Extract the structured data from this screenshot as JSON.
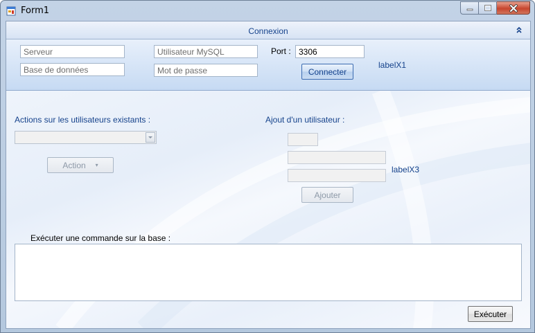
{
  "window": {
    "title": "Form1"
  },
  "connexion": {
    "title": "Connexion",
    "server_placeholder": "Serveur",
    "database_placeholder": "Base de données",
    "mysql_user_placeholder": "Utilisateur MySQL",
    "password_placeholder": "Mot de passe",
    "port_label": "Port :",
    "port_value": "3306",
    "connect_label": "Connecter",
    "status_label": "labelX1"
  },
  "existing_users": {
    "heading": "Actions sur les utilisateurs existants :",
    "user_select_value": "",
    "action_label": "Action"
  },
  "add_user": {
    "heading": "Ajout d'un utilisateur :",
    "field1_value": "",
    "field2_value": "",
    "field3_value": "",
    "status_label": "labelX3",
    "add_label": "Ajouter"
  },
  "command": {
    "heading": "Exécuter une commande sur la base :",
    "value": "",
    "execute_label": "Exécuter"
  },
  "icons": {
    "app": "form-app-icon",
    "minimize": "minimize-icon",
    "maximize": "maximize-icon",
    "close": "close-icon",
    "collapse": "double-chevron-up-icon",
    "dropdown": "chevron-down-icon"
  }
}
